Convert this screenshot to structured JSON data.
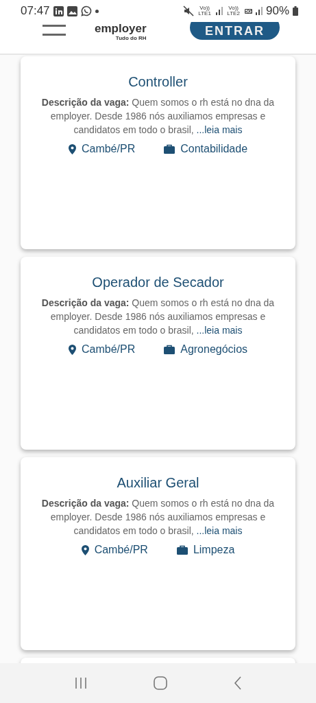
{
  "status_bar": {
    "time": "07:47",
    "sim1": "Vo)) LTE1",
    "sim2": "Vo)) LTE2",
    "network": "5G",
    "battery": "90%"
  },
  "header": {
    "logo": "employer",
    "tagline": "Tudo do RH",
    "login_button": "ENTRAR"
  },
  "jobs": [
    {
      "title": "Controller",
      "description_label": "Descrição da vaga:",
      "description": "Quem somos o rh está no dna da employer. Desde 1986 nós auxiliamos empresas e candidatos em todo o brasil,",
      "read_more": "...leia mais",
      "location": "Cambé/PR",
      "area": "Contabilidade"
    },
    {
      "title": "Operador de Secador",
      "description_label": "Descrição da vaga:",
      "description": "Quem somos o rh está no dna da employer. Desde 1986 nós auxiliamos empresas e candidatos em todo o brasil,",
      "read_more": "...leia mais",
      "location": "Cambé/PR",
      "area": "Agronegócios"
    },
    {
      "title": "Auxiliar Geral",
      "description_label": "Descrição da vaga:",
      "description": "Quem somos o rh está no dna da employer. Desde 1986 nós auxiliamos empresas e candidatos em todo o brasil,",
      "read_more": "...leia mais",
      "location": "Cambé/PR",
      "area": "Limpeza"
    }
  ],
  "more_cards_below": true
}
